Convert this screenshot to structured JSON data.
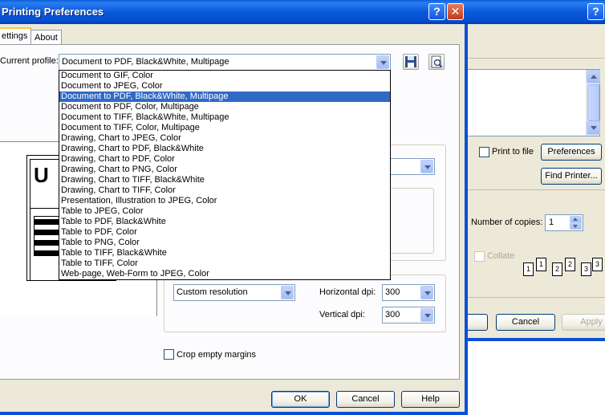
{
  "front_window": {
    "title": "Printing Preferences",
    "tabs": [
      {
        "label": "ettings",
        "active": true
      },
      {
        "label": "About",
        "active": false
      }
    ],
    "profile": {
      "label": "Current profile:",
      "value": "Document to PDF, Black&White, Multipage"
    },
    "profile_options": [
      "Document to GIF, Color",
      "Document to JPEG, Color",
      "Document to PDF, Black&White, Multipage",
      "Document to PDF, Color, Multipage",
      "Document to TIFF, Black&White, Multipage",
      "Document to TIFF, Color, Multipage",
      "Drawing, Chart to JPEG, Color",
      "Drawing, Chart to PDF, Black&White",
      "Drawing, Chart to PDF, Color",
      "Drawing, Chart to PNG, Color",
      "Drawing, Chart to TIFF, Black&White",
      "Drawing, Chart to TIFF, Color",
      "Presentation, Illustration to JPEG, Color",
      "Table to JPEG, Color",
      "Table to PDF, Black&White",
      "Table to PDF, Color",
      "Table to PNG, Color",
      "Table to TIFF, Black&White",
      "Table to TIFF, Color",
      "Web-page, Web-Form to JPEG, Color"
    ],
    "selected_option_index": 2,
    "preview_letter": "U",
    "resolution": {
      "mode": "Custom resolution",
      "horizontal_label": "Horizontal dpi:",
      "horizontal_value": "300",
      "vertical_label": "Vertical dpi:",
      "vertical_value": "300"
    },
    "crop_label": "Crop empty margins",
    "buttons": {
      "ok": "OK",
      "cancel": "Cancel",
      "help": "Help"
    },
    "caption_help": "?",
    "caption_close": "✕"
  },
  "back_window": {
    "caption_help": "?",
    "print_to_file_label": "Print to file",
    "preferences_button": "Preferences",
    "find_printer_button": "Find Printer...",
    "copies_label": "Number of copies:",
    "copies_value": "1",
    "collate_label": "Collate",
    "collate_pages": [
      "1",
      "1",
      "2",
      "2",
      "3",
      "3"
    ],
    "cancel_button": "Cancel",
    "apply_button": "Apply"
  }
}
